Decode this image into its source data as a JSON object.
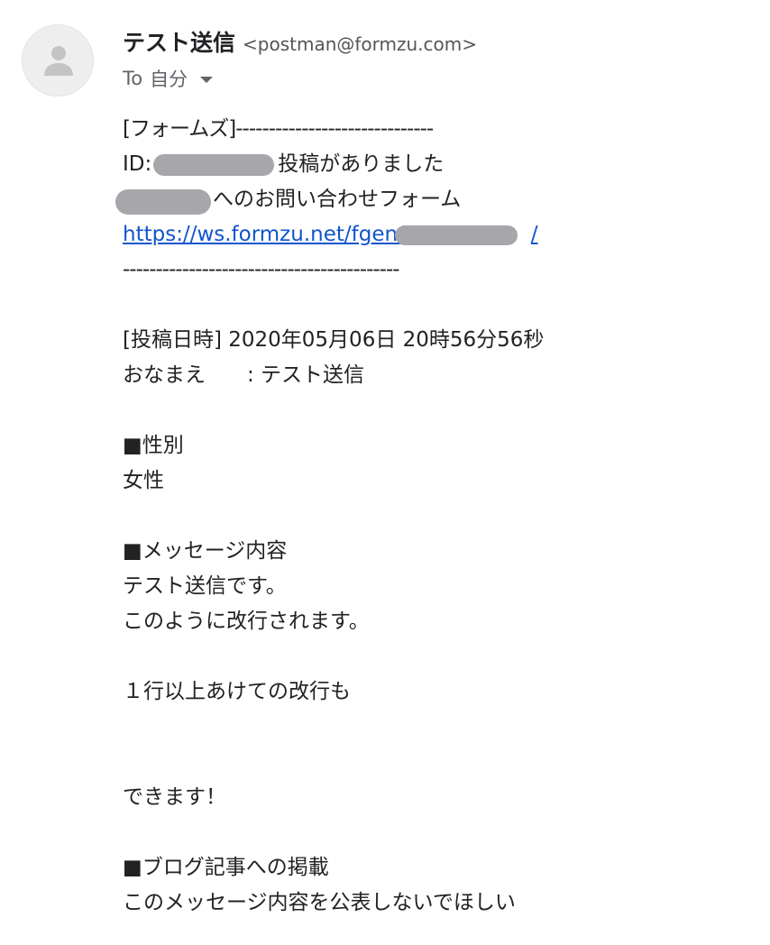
{
  "header": {
    "sender_name": "テスト送信",
    "sender_email": "<postman@formzu.com>",
    "to_prefix": "To",
    "to_value": "自分"
  },
  "body": {
    "line_1": "[フォームズ]------------------------------",
    "line_2_prefix": "ID:",
    "line_2_suffix": "投稿がありました",
    "line_3_suffix": "へのお問い合わせフォーム",
    "line_4_link": "https://ws.formzu.net/fgen/",
    "line_4_link_end": "/",
    "line_5": "------------------------------------------",
    "line_posted": "[投稿日時] 2020年05月06日 20時56分56秒",
    "line_name": "おなまえ　　: テスト送信",
    "gender_heading": "■性別",
    "gender_value": "女性",
    "message_heading": "■メッセージ内容",
    "message_line_1": "テスト送信です。",
    "message_line_2": "このように改行されます。",
    "message_line_3": "１行以上あけての改行も",
    "message_line_4": "できます！",
    "blog_heading": "■ブログ記事への掲載",
    "blog_value": "このメッセージ内容を公表しないでほしい"
  },
  "colors": {
    "link": "#1155cc",
    "redaction": "#a7a7ab",
    "avatar_bg": "#eeeeee",
    "avatar_icon": "#c4c4c4"
  }
}
